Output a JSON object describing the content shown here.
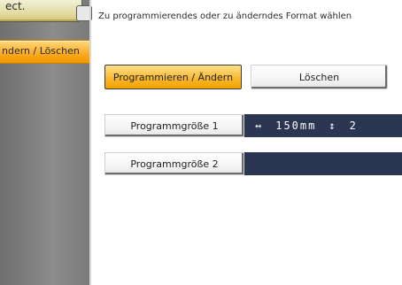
{
  "sidebar": {
    "top_tab_label": "ect.",
    "active_item_label": "ndern / Löschen"
  },
  "main": {
    "instruction": "Zu programmierendes oder zu änderndes Format wählen",
    "buttons": {
      "program_change": "Programmieren / Ändern",
      "delete": "Löschen"
    },
    "sizes": [
      {
        "label": "Programmgröße 1",
        "h_arrow": "↔",
        "width": "150mm",
        "v_arrow": "↕",
        "height": "2"
      },
      {
        "label": "Programmgröße 2"
      }
    ]
  },
  "colors": {
    "accent_orange": "#f7a316",
    "value_bar": "#2b3652",
    "sidebar_bg": "#7f7f7f"
  }
}
